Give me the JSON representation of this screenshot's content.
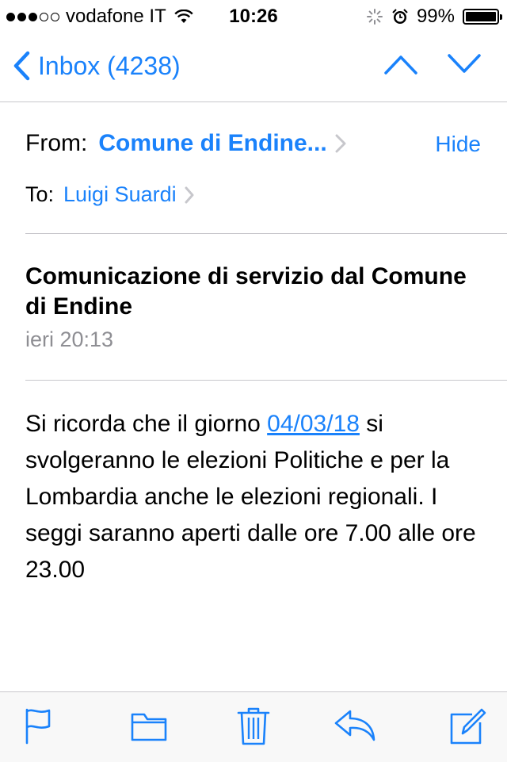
{
  "status_bar": {
    "carrier": "vodafone IT",
    "time": "10:26",
    "battery": "99%",
    "battery_level": 0.99,
    "icons": [
      "signal-dots-icon",
      "wifi-icon",
      "activity-spinner-icon",
      "alarm-icon",
      "battery-icon"
    ]
  },
  "nav": {
    "back_label": "Inbox (4238)",
    "icons": [
      "chevron-left-icon",
      "chevron-up-icon",
      "chevron-down-icon"
    ]
  },
  "header": {
    "from_label": "From:",
    "from_name": "Comune di Endine...",
    "hide_label": "Hide",
    "to_label": "To:",
    "to_name": "Luigi Suardi"
  },
  "message": {
    "subject": "Comunicazione di servizio dal Comune di Endine",
    "date": "ieri 20:13",
    "body_before": "Si ricorda che il giorno ",
    "body_link": "04/03/18",
    "body_after": " si svolgeranno le elezioni Politiche e per la Lombardia anche le elezioni regionali. I seggi saranno aperti dalle ore 7.00 alle ore 23.00"
  },
  "toolbar": {
    "icons": [
      "flag-icon",
      "folder-icon",
      "trash-icon",
      "reply-icon",
      "compose-icon"
    ]
  },
  "colors": {
    "accent": "#1a82fb",
    "secondary_text": "#8e8e93",
    "separator": "#c8c7cc"
  }
}
